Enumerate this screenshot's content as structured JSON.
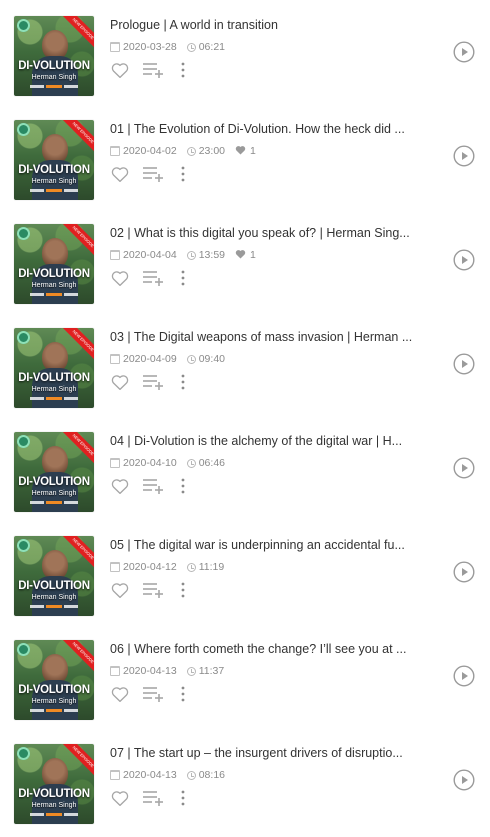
{
  "cover": {
    "title": "DI-VOLUTION",
    "author": "Herman Singh",
    "ribbon": "NEW EPISODE"
  },
  "episodes": [
    {
      "title": "Prologue | A world in transition",
      "date": "2020-03-28",
      "duration": "06:21",
      "likes": ""
    },
    {
      "title": "01 | The Evolution of Di-Volution. How the heck did ...",
      "date": "2020-04-02",
      "duration": "23:00",
      "likes": "1"
    },
    {
      "title": "02 | What is this digital you speak of? | Herman Sing...",
      "date": "2020-04-04",
      "duration": "13:59",
      "likes": "1"
    },
    {
      "title": "03 | The Digital weapons of mass invasion | Herman ...",
      "date": "2020-04-09",
      "duration": "09:40",
      "likes": ""
    },
    {
      "title": "04 | Di-Volution is the alchemy of the digital war | H...",
      "date": "2020-04-10",
      "duration": "06:46",
      "likes": ""
    },
    {
      "title": "05 | The digital war is underpinning an accidental fu...",
      "date": "2020-04-12",
      "duration": "11:19",
      "likes": ""
    },
    {
      "title": "06 | Where forth cometh the change? I’ll see you at ...",
      "date": "2020-04-13",
      "duration": "11:37",
      "likes": ""
    },
    {
      "title": "07 | The start up – the insurgent drivers of disruptio...",
      "date": "2020-04-13",
      "duration": "08:16",
      "likes": ""
    }
  ],
  "icons": {
    "date": "calendar-icon",
    "duration": "clock-icon",
    "likes": "heart-icon",
    "like_action": "heart-outline-icon",
    "add_to_playlist": "playlist-add-icon",
    "more": "more-vertical-icon",
    "play": "play-circle-icon"
  },
  "colors": {
    "title_text": "#333333",
    "meta_text": "#8a8a8a",
    "icon_gray": "#9a9a9a",
    "cover_ribbon": "#e02020"
  }
}
